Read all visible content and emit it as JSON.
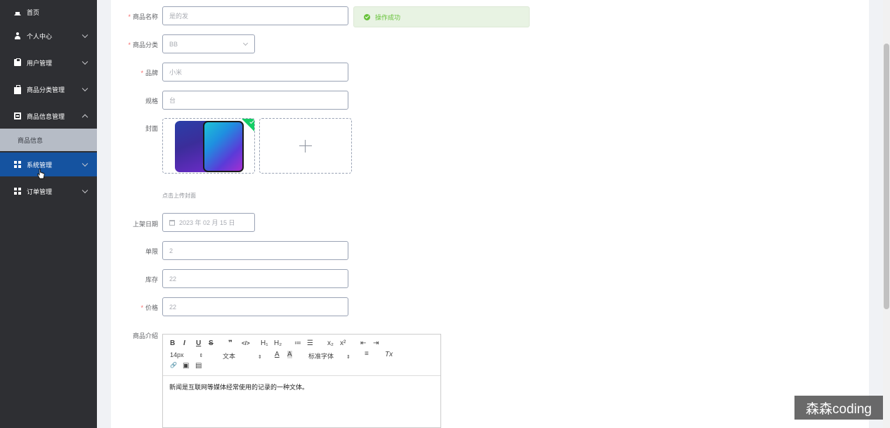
{
  "sidebar": {
    "items": [
      {
        "label": "首页",
        "icon": "home-icon"
      },
      {
        "label": "个人中心",
        "icon": "user-icon"
      },
      {
        "label": "用户管理",
        "icon": "clipboard-icon"
      },
      {
        "label": "商品分类管理",
        "icon": "bag-icon"
      },
      {
        "label": "商品信息管理",
        "icon": "box-icon"
      },
      {
        "label": "系统管理",
        "icon": "table-icon"
      },
      {
        "label": "订单管理",
        "icon": "grid-icon"
      }
    ],
    "sub_item": "商品信息",
    "active_color": "#1553a0",
    "bg_color": "#2e2f33"
  },
  "form": {
    "name": {
      "label": "商品名称",
      "value": "是的发"
    },
    "category": {
      "label": "商品分类",
      "value": "BB"
    },
    "brand": {
      "label": "品牌",
      "value": "小米"
    },
    "spec": {
      "label": "规格",
      "value": "台"
    },
    "cover": {
      "label": "封面",
      "hint": "点击上传封面"
    },
    "date": {
      "label": "上架日期",
      "value": "2023 年 02 月 15 日"
    },
    "limit": {
      "label": "单限",
      "value": "2"
    },
    "stock": {
      "label": "库存",
      "value": "22"
    },
    "price": {
      "label": "价格",
      "value": "22"
    },
    "intro": {
      "label": "商品介绍"
    }
  },
  "toast": {
    "message": "操作成功",
    "color": "#67c23a"
  },
  "editor": {
    "toolbar": {
      "bold": "B",
      "italic": "I",
      "underline": "U",
      "strike": "S",
      "quote": "❞",
      "code": "</>",
      "h1": "H₁",
      "h2": "H₂",
      "ordered": "≔",
      "bullet": "☰",
      "sub": "x₂",
      "sup": "x²",
      "outdent": "⇤",
      "indent": "⇥",
      "size": "14px",
      "header": "文本",
      "color": "A",
      "bg": "A",
      "font": "标准字体",
      "align": "≡",
      "clean": "Tx",
      "link": "🔗",
      "image": "▣",
      "video": "▤"
    },
    "content": "新闻是互联网等媒体经常使用的记录的一种文体。"
  },
  "watermark": "森森coding"
}
